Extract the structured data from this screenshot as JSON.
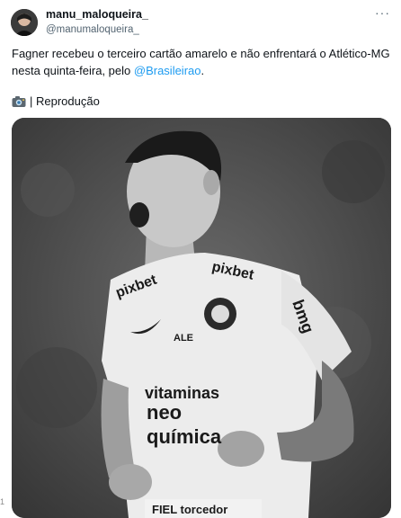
{
  "tweet": {
    "display_name": "manu_maloqueira_",
    "handle": "@manumaloqueira_",
    "text_before_mention": "Fagner recebeu o terceiro cartão amarelo e não enfrentará o Atlético-MG nesta quinta-feira, pelo ",
    "mention": "@Brasileirao",
    "text_after_mention": ".",
    "credit_label": "| Reprodução",
    "more_glyph": "···"
  },
  "media": {
    "shirt_sponsor_left": "pixbet",
    "shirt_sponsor_right": "pixbet",
    "chest_sponsor_line1": "vitaminas",
    "chest_sponsor_line2": "neo",
    "chest_sponsor_line3": "química",
    "sleeve_sponsor": "bmg",
    "kit_brand": "ALE",
    "bottom_banner": "FIEL torcedor"
  },
  "icons": {
    "avatar": "user-avatar",
    "camera": "camera-icon",
    "more": "more-options-icon"
  },
  "edge_mark": "1"
}
